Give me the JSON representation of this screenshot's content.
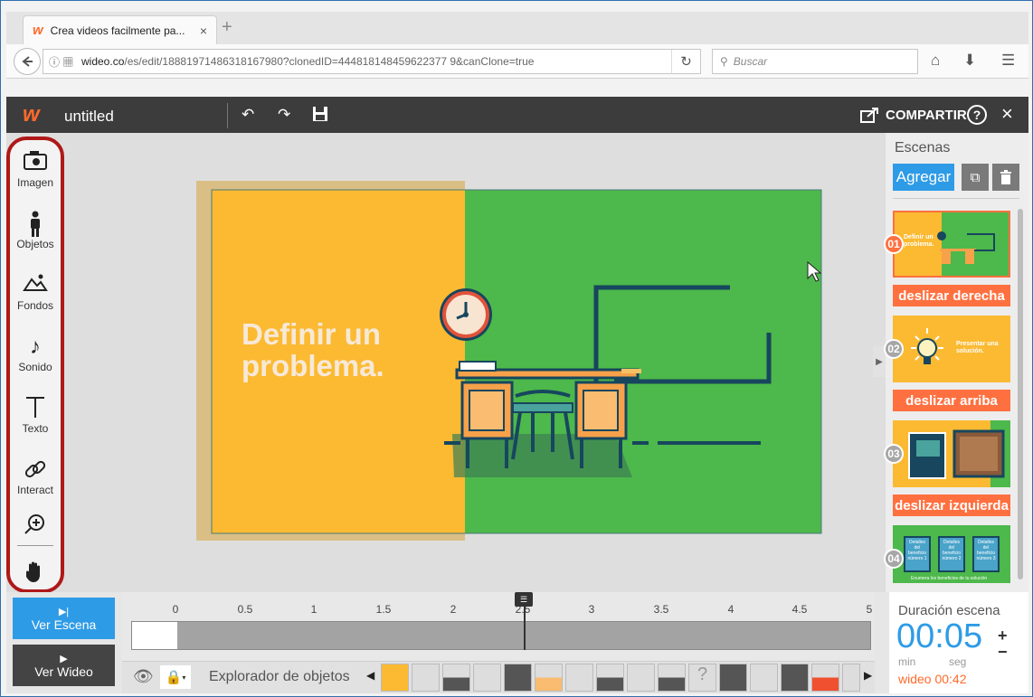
{
  "browser": {
    "tab_title": "Crea videos facilmente pa...",
    "tab_close": "×",
    "new_tab": "+",
    "url_host": "wideo.co",
    "url_path": "/es/edit/18881971486318167980?clonedID=444818148459622377 9&canClone=true",
    "search_placeholder": "Buscar"
  },
  "app": {
    "title": "untitled",
    "share_label": "COMPARTIR",
    "help_label": "?",
    "close_label": "×"
  },
  "tools": [
    {
      "label": "Imagen",
      "icon": "camera-icon"
    },
    {
      "label": "Objetos",
      "icon": "person-icon"
    },
    {
      "label": "Fondos",
      "icon": "mountain-icon"
    },
    {
      "label": "Sonido",
      "icon": "music-note-icon"
    },
    {
      "label": "Texto",
      "icon": "text-icon"
    },
    {
      "label": "Interact",
      "icon": "link-icon"
    }
  ],
  "stage": {
    "headline_line1": "Definir un",
    "headline_line2": "problema.",
    "colors": {
      "left": "#fbba32",
      "right": "#4db84b",
      "frame": "#d9bf85"
    }
  },
  "scenes": {
    "title": "Escenas",
    "add_label": "Agregar",
    "items": [
      {
        "num": "01",
        "transition": "deslizar derecha",
        "thumb_text": "Definir un problema."
      },
      {
        "num": "02",
        "transition": "deslizar arriba",
        "thumb_text": "Presentar una solución."
      },
      {
        "num": "03",
        "transition": "deslizar izquierda",
        "thumb_text": ""
      },
      {
        "num": "04",
        "transition": "",
        "thumb_text": "Enumera los beneficios de tu solución"
      }
    ],
    "thumb4_cards": [
      "Detalles del beneficio número 1",
      "Detalles del beneficio número 2",
      "Detalles del beneficio número 3"
    ]
  },
  "timeline": {
    "ver_escena": "Ver Escena",
    "ver_wideo": "Ver Wideo",
    "ticks": [
      "0",
      "0.5",
      "1",
      "1.5",
      "2",
      "2.5",
      "3",
      "3.5",
      "4",
      "4.5",
      "5"
    ],
    "explorer_label": "Explorador de objetos",
    "playhead_label": "☰"
  },
  "duration": {
    "label": "Duración escena",
    "value": "00:05",
    "min_label": "min",
    "seg_label": "seg",
    "wideo_total": "wideo 00:42",
    "plus": "+",
    "minus": "−"
  }
}
